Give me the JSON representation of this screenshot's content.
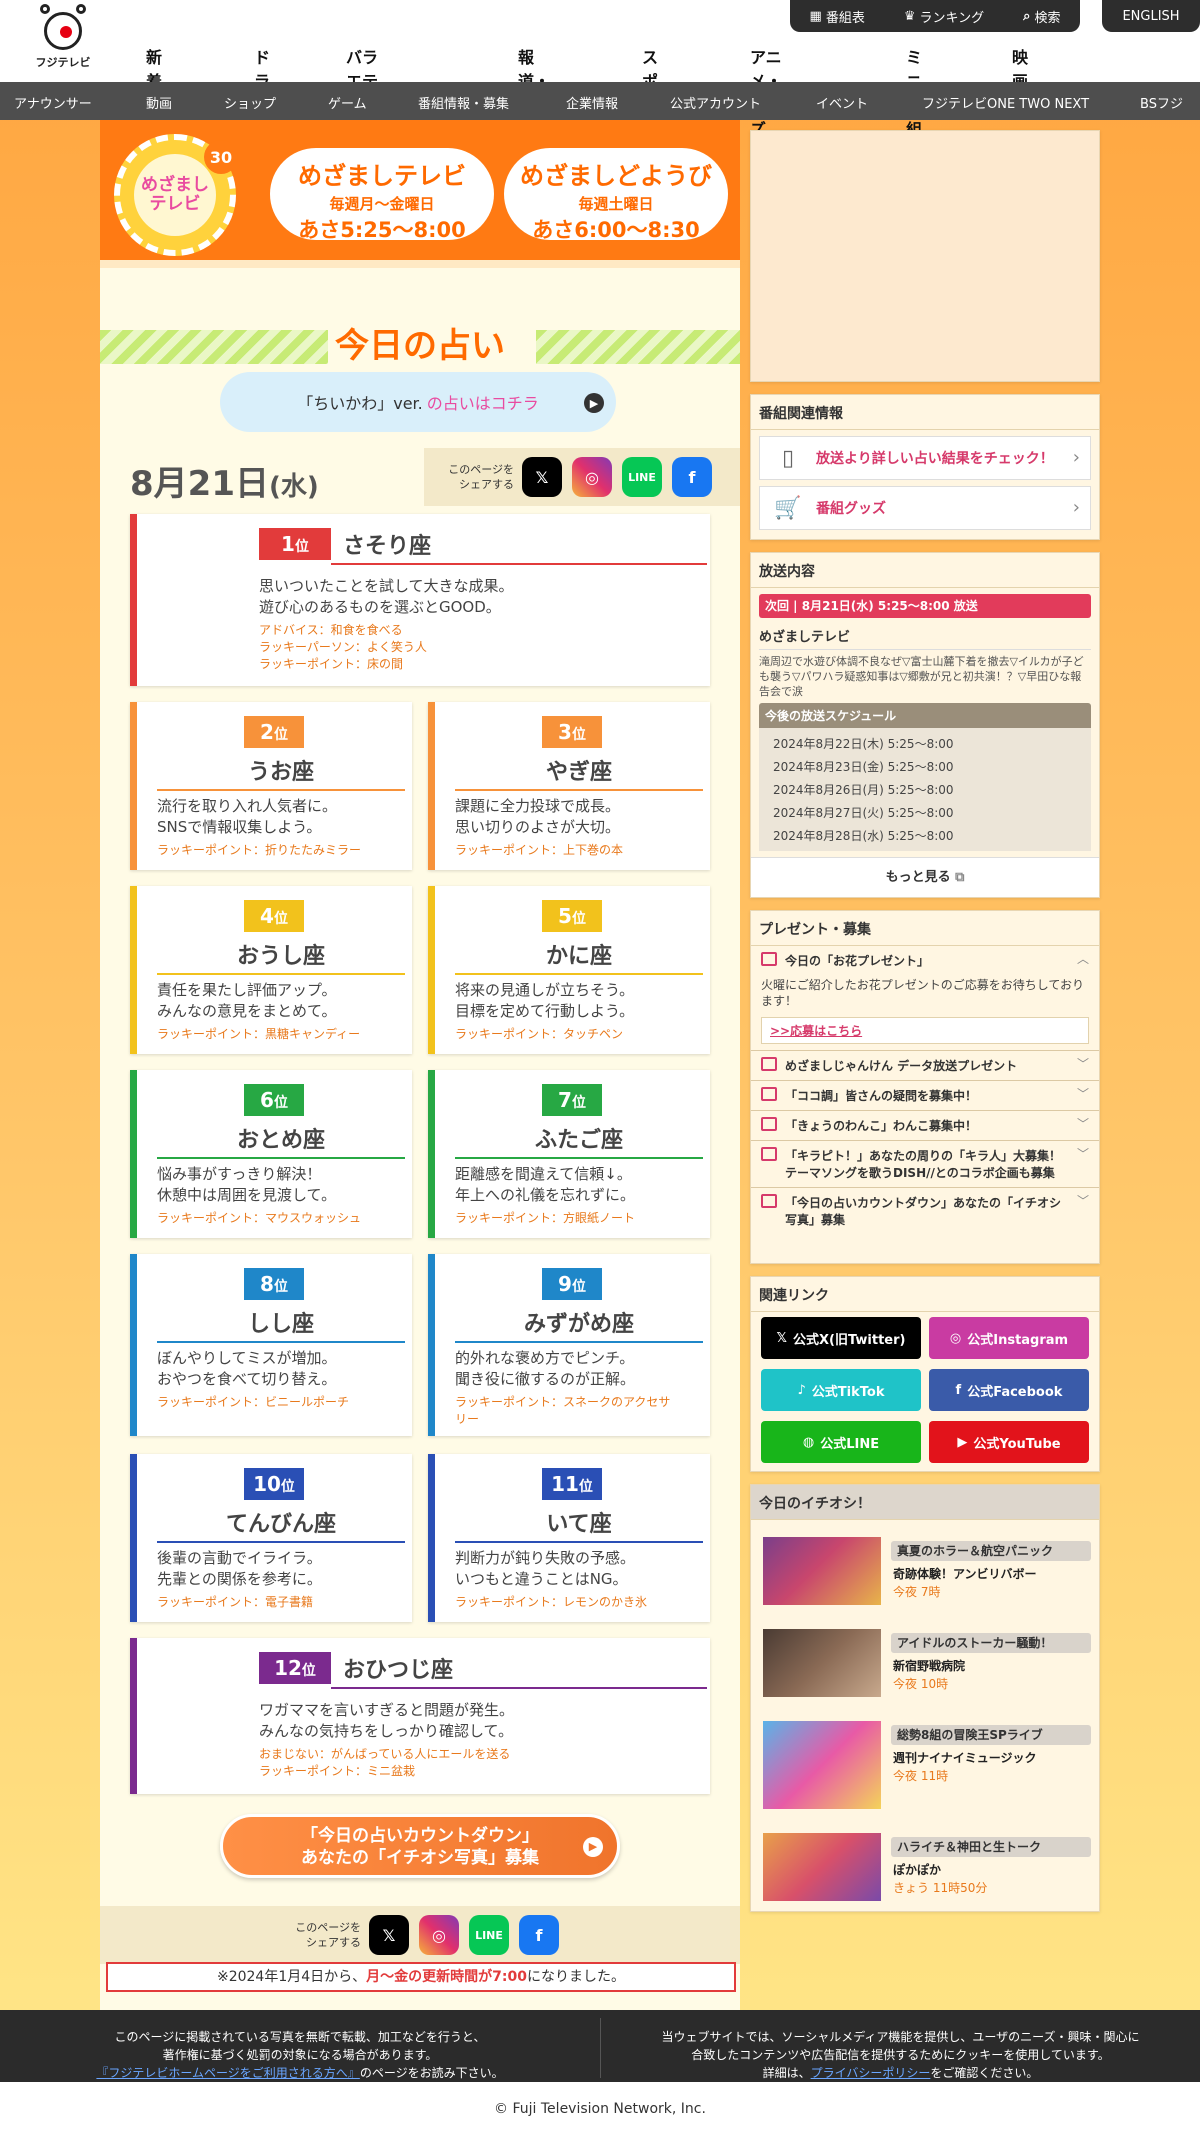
{
  "header": {
    "logo_text": "フジテレビ",
    "nav": [
      "新着記事",
      "ドラマ",
      "バラエティ・音楽",
      "報道・情報",
      "スポーツ",
      "アニメ・キッズ",
      "ミニ番組",
      "映画"
    ],
    "top_links": [
      "番組表",
      "ランキング",
      "検索"
    ],
    "english": "ENGLISH",
    "subnav": [
      "アナウンサー",
      "動画",
      "ショップ",
      "ゲーム",
      "番組情報・募集",
      "企業情報",
      "公式アカウント",
      "イベント",
      "フジテレビONE TWO NEXT",
      "BSフジ"
    ]
  },
  "banner": {
    "logo_line1": "めざまし",
    "logo_line2": "テレビ",
    "logo_badge": "30",
    "weekday": {
      "title": "めざましテレビ",
      "days": "毎週月〜金曜日",
      "time": "あさ5:25〜8:00"
    },
    "saturday": {
      "title": "めざましどようび",
      "days": "毎週土曜日",
      "time": "あさ6:00〜8:30"
    }
  },
  "page": {
    "title": "今日の占い",
    "chiikawa_a": "「ちいかわ」ver.",
    "chiikawa_b": "の占いはコチラ",
    "date_main": "8月21日",
    "date_day": "(水)",
    "share_label": "このページを\nシェアする",
    "share_buttons": [
      "X",
      "Instagram",
      "LINE",
      "Facebook"
    ]
  },
  "fortunes": [
    {
      "rank": "1",
      "rank_unit": "位",
      "sign": "さそり座",
      "desc": "思いついたことを試して大きな成果。\n遊び心のあるものを選ぶとGOOD。",
      "lucky": "アドバイス：和食を食べる\nラッキーパーソン：よく笑う人\nラッキーポイント：床の間"
    },
    {
      "rank": "2",
      "rank_unit": "位",
      "sign": "うお座",
      "desc": "流行を取り入れ人気者に。\nSNSで情報収集しよう。",
      "lucky": "ラッキーポイント：折りたたみミラー"
    },
    {
      "rank": "3",
      "rank_unit": "位",
      "sign": "やぎ座",
      "desc": "課題に全力投球で成長。\n思い切りのよさが大切。",
      "lucky": "ラッキーポイント：上下巻の本"
    },
    {
      "rank": "4",
      "rank_unit": "位",
      "sign": "おうし座",
      "desc": "責任を果たし評価アップ。\nみんなの意見をまとめて。",
      "lucky": "ラッキーポイント：黒糖キャンディー"
    },
    {
      "rank": "5",
      "rank_unit": "位",
      "sign": "かに座",
      "desc": "将来の見通しが立ちそう。\n目標を定めて行動しよう。",
      "lucky": "ラッキーポイント：タッチペン"
    },
    {
      "rank": "6",
      "rank_unit": "位",
      "sign": "おとめ座",
      "desc": "悩み事がすっきり解決！\n休憩中は周囲を見渡して。",
      "lucky": "ラッキーポイント：マウスウォッシュ"
    },
    {
      "rank": "7",
      "rank_unit": "位",
      "sign": "ふたご座",
      "desc": "距離感を間違えて信頼↓。\n年上への礼儀を忘れずに。",
      "lucky": "ラッキーポイント：方眼紙ノート"
    },
    {
      "rank": "8",
      "rank_unit": "位",
      "sign": "しし座",
      "desc": "ぼんやりしてミスが増加。\nおやつを食べて切り替え。",
      "lucky": "ラッキーポイント：ビニールポーチ"
    },
    {
      "rank": "9",
      "rank_unit": "位",
      "sign": "みずがめ座",
      "desc": "的外れな褒め方でピンチ。\n聞き役に徹するのが正解。",
      "lucky": "ラッキーポイント：スネークのアクセサ\nリー"
    },
    {
      "rank": "10",
      "rank_unit": "位",
      "sign": "てんびん座",
      "desc": "後輩の言動でイライラ。\n先輩との関係を参考に。",
      "lucky": "ラッキーポイント：電子書籍"
    },
    {
      "rank": "11",
      "rank_unit": "位",
      "sign": "いて座",
      "desc": "判断力が鈍り失敗の予感。\nいつもと違うことはNG。",
      "lucky": "ラッキーポイント：レモンのかき氷"
    },
    {
      "rank": "12",
      "rank_unit": "位",
      "sign": "おひつじ座",
      "desc": "ワガママを言いすぎると問題が発生。\nみんなの気持ちをしっかり確認して。",
      "lucky": "おまじない：がんばっている人にエールを送る\nラッキーポイント：ミニ盆栽"
    }
  ],
  "rank_colors": [
    "#e23b3b",
    "#f7923a",
    "#f7923a",
    "#f2c21c",
    "#f2c21c",
    "#27a844",
    "#27a844",
    "#1f87c9",
    "#1f87c9",
    "#2a4fb5",
    "#2a4fb5",
    "#7b2a8e"
  ],
  "countdown_button": "「今日の占いカウントダウン」\nあなたの「イチオシ写真」募集",
  "notice": {
    "a": "※2024年1月4日から、",
    "b": "月〜金の更新時間が7:00",
    "c": "になりました。"
  },
  "sidebar": {
    "related_title": "番組関連情報",
    "related": [
      "放送より詳しい占い結果をチェック！",
      "番組グッズ"
    ],
    "broadcast_title": "放送内容",
    "next": "次回 | 8月21日(水) 5:25〜8:00 放送",
    "program": "めざましテレビ",
    "program_desc": "滝周辺で水遊び体調不良なぜ▽富士山麓下着を撤去▽イルカが子ども襲う▽パワハラ疑惑知事は▽郷敷が兄と初共演！？▽早田ひな報告会で涙",
    "schedule_title": "今後の放送スケジュール",
    "schedule": [
      "2024年8月22日(木) 5:25〜8:00",
      "2024年8月23日(金) 5:25〜8:00",
      "2024年8月26日(月) 5:25〜8:00",
      "2024年8月27日(火) 5:25〜8:00",
      "2024年8月28日(水) 5:25〜8:00"
    ],
    "more": "もっと見る",
    "present_title": "プレゼント・募集",
    "present_open": "今日の「お花プレゼント」",
    "present_open_desc": "火曜にご紹介したお花プレゼントのご応募をお待ちしております！",
    "apply": ">>応募はこちら",
    "presents": [
      "めざましじゃんけん データ放送プレゼント",
      "「ココ調」皆さんの疑問を募集中！",
      "「きょうのわんこ」わんこ募集中！",
      "「キラピト！」あなたの周りの「キラ人」大募集！テーマソングを歌うDISH//とのコラボ企画も募集",
      "「今日の占いカウントダウン」あなたの「イチオシ写真」募集"
    ],
    "links_title": "関連リンク",
    "links": [
      "公式X(旧Twitter)",
      "公式Instagram",
      "公式TikTok",
      "公式Facebook",
      "公式LINE",
      "公式YouTube"
    ],
    "pick_title": "今日のイチオシ！",
    "picks": [
      {
        "tag": "真夏のホラー＆航空パニック",
        "name": "奇跡体験！アンビリバボー",
        "time": "今夜 7時"
      },
      {
        "tag": "アイドルのストーカー騒動！",
        "name": "新宿野戦病院",
        "time": "今夜 10時"
      },
      {
        "tag": "総勢8組の冒険王SPライブ",
        "name": "週刊ナイナイミュージック",
        "time": "今夜 11時"
      },
      {
        "tag": "ハライチ＆神田と生トーク",
        "name": "ぽかぽか",
        "time": "きょう 11時50分"
      }
    ]
  },
  "footer": {
    "left1": "このページに掲載されている写真を無断で転載、加工などを行うと、",
    "left2": "著作権に基づく処罰の対象になる場合があります。",
    "left_link": "『フジテレビホームページをご利用される方へ』",
    "left3": "のページをお読み下さい。",
    "right1": "当ウェブサイトでは、ソーシャルメディア機能を提供し、ユーザのニーズ・興味・関心に",
    "right2": "合致したコンテンツや広告配信を提供するためにクッキーを使用しています。",
    "right3a": "詳細は、",
    "right_link": "プライバシーポリシー",
    "right3b": "をご確認ください。",
    "copyright": "© Fuji Television Network, Inc."
  }
}
